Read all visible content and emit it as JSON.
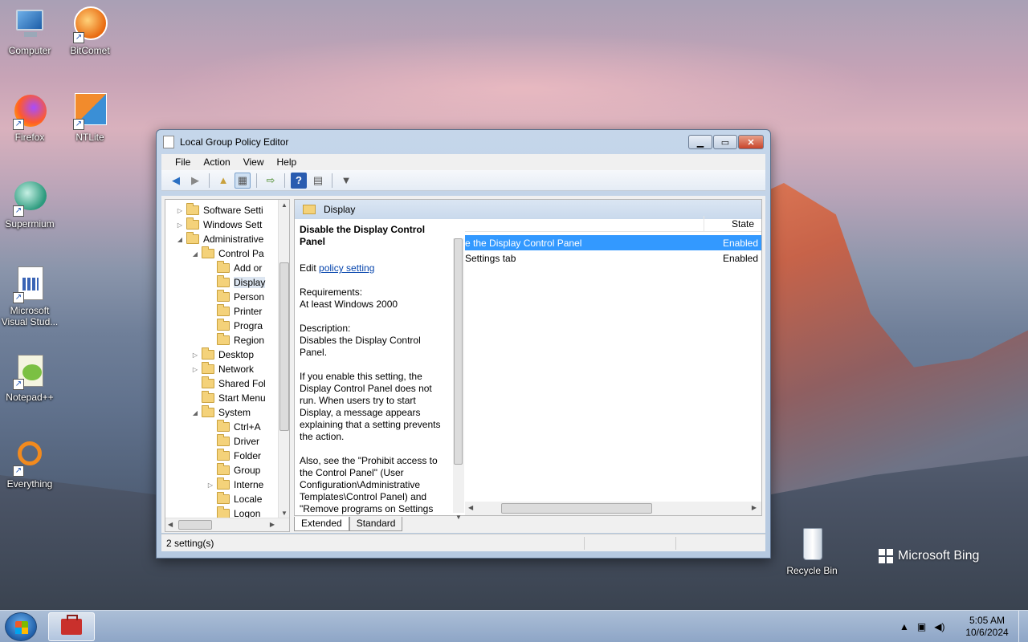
{
  "desktop": {
    "icons": [
      {
        "label": "Computer"
      },
      {
        "label": "BitComet"
      },
      {
        "label": "Firefox"
      },
      {
        "label": "NTLite"
      },
      {
        "label": "Supermium"
      },
      {
        "label": "Microsoft Visual Stud..."
      },
      {
        "label": "Notepad++"
      },
      {
        "label": "Everything"
      },
      {
        "label": "Recycle Bin"
      }
    ],
    "watermark": "Microsoft Bing"
  },
  "window": {
    "title": "Local Group Policy Editor",
    "menu": [
      "File",
      "Action",
      "View",
      "Help"
    ],
    "tree": [
      {
        "label": "Software Setti",
        "arrow": "▷",
        "indent": 0
      },
      {
        "label": "Windows Sett",
        "arrow": "▷",
        "indent": 0
      },
      {
        "label": "Administrative",
        "arrow": "◢",
        "indent": 0
      },
      {
        "label": "Control Pa",
        "arrow": "◢",
        "indent": 1
      },
      {
        "label": "Add or",
        "arrow": "",
        "indent": 2
      },
      {
        "label": "Display",
        "arrow": "",
        "indent": 2,
        "selected": true
      },
      {
        "label": "Person",
        "arrow": "",
        "indent": 2
      },
      {
        "label": "Printer",
        "arrow": "",
        "indent": 2
      },
      {
        "label": "Progra",
        "arrow": "",
        "indent": 2
      },
      {
        "label": "Region",
        "arrow": "",
        "indent": 2
      },
      {
        "label": "Desktop",
        "arrow": "▷",
        "indent": 1
      },
      {
        "label": "Network",
        "arrow": "▷",
        "indent": 1
      },
      {
        "label": "Shared Fol",
        "arrow": "",
        "indent": 1
      },
      {
        "label": "Start Menu",
        "arrow": "",
        "indent": 1
      },
      {
        "label": "System",
        "arrow": "◢",
        "indent": 1
      },
      {
        "label": "Ctrl+A",
        "arrow": "",
        "indent": 2
      },
      {
        "label": "Driver",
        "arrow": "",
        "indent": 2
      },
      {
        "label": "Folder",
        "arrow": "",
        "indent": 2
      },
      {
        "label": "Group",
        "arrow": "",
        "indent": 2
      },
      {
        "label": "Interne",
        "arrow": "▷",
        "indent": 2
      },
      {
        "label": "Locale",
        "arrow": "",
        "indent": 2
      },
      {
        "label": "Logon",
        "arrow": "",
        "indent": 2
      }
    ],
    "pane_header": "Display",
    "description": {
      "heading": "Disable the Display Control Panel",
      "edit_prefix": "Edit ",
      "edit_link": "policy setting",
      "requirements_label": "Requirements:",
      "requirements": "At least Windows 2000",
      "description_label": "Description:",
      "description": "Disables the Display Control Panel.",
      "para1": "If you enable this setting, the Display Control Panel does not run. When users try to start Display, a message appears explaining that a setting prevents the action.",
      "para2": "Also, see the \"Prohibit access to the Control Panel\" (User Configuration\\Administrative Templates\\Control Panel) and \"Remove programs on Settings menu\" (User Configuration\\Administrative"
    },
    "list": {
      "col_state": "State",
      "rows": [
        {
          "setting": "e the Display Control Panel",
          "state": "Enabled",
          "selected": true
        },
        {
          "setting": "Settings tab",
          "state": "Enabled",
          "selected": false
        }
      ]
    },
    "tabs": [
      "Extended",
      "Standard"
    ],
    "status": "2 setting(s)"
  },
  "taskbar": {
    "time": "5:05 AM",
    "date": "10/6/2024"
  }
}
